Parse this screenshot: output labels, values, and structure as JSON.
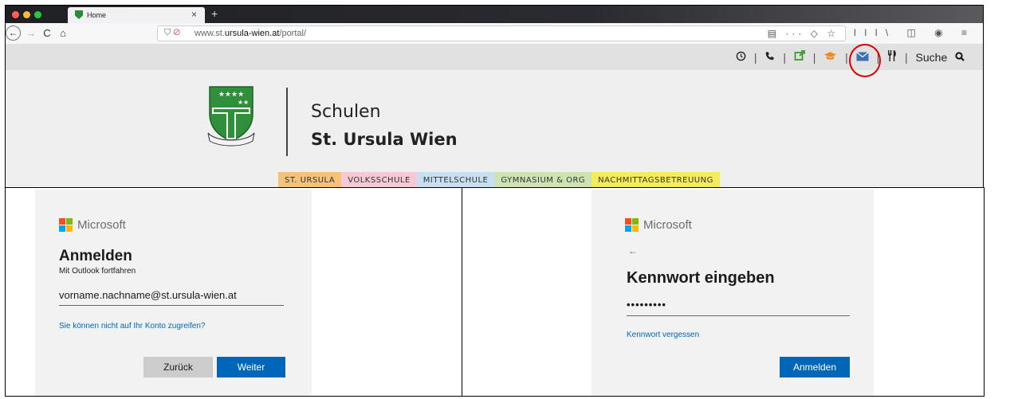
{
  "browser": {
    "tab_title": "Home",
    "tab_close": "×",
    "new_tab": "+",
    "url_prefix": "www.st.",
    "url_domain": "ursula-wien.at",
    "url_path": "/portal/",
    "nav": {
      "back": "←",
      "forward": "→",
      "reload": "C",
      "home": "⌂"
    },
    "url_icons": {
      "reader": "▤",
      "more": "···",
      "pocket": "◇",
      "bookmark": "☆"
    },
    "tool_icons": {
      "library": "III\\",
      "sidebar": "◫",
      "account": "◉",
      "menu": "≡"
    }
  },
  "site": {
    "utility": {
      "clock_icon": "clock-icon",
      "phone_icon": "phone-icon",
      "external_icon": "external-link-icon",
      "graduation_icon": "graduation-cap-icon",
      "mail_icon": "mail-icon",
      "food_icon": "cutlery-icon",
      "separator": "|",
      "search_label": "Suche"
    },
    "brand_line1": "Schulen",
    "brand_line2": "St. Ursula Wien",
    "menu": [
      {
        "label": "ST. URSULA",
        "color": "#f5c27a"
      },
      {
        "label": "VOLKSSCHULE",
        "color": "#f6c9d6"
      },
      {
        "label": "MITTELSCHULE",
        "color": "#c7dff0"
      },
      {
        "label": "GYMNASIUM & ORG",
        "color": "#cfe3b2"
      },
      {
        "label": "NACHMITTAGSBETREUUNG",
        "color": "#f5ec5c"
      }
    ],
    "highlight_color": "#dd0000"
  },
  "signin": {
    "brand": "Microsoft",
    "title": "Anmelden",
    "subtitle": "Mit Outlook fortfahren",
    "email_value": "vorname.nachname@st.ursula-wien.at",
    "help_link": "Sie können nicht auf Ihr Konto zugreifen?",
    "back_button": "Zurück",
    "next_button": "Weiter"
  },
  "password": {
    "brand": "Microsoft",
    "back_arrow": "←",
    "title": "Kennwort eingeben",
    "password_value": "•••••••••",
    "forgot_link": "Kennwort vergessen",
    "submit_button": "Anmelden"
  },
  "colors": {
    "ms_blue": "#0067b8",
    "ms_logo": [
      "#f25022",
      "#7fba00",
      "#00a4ef",
      "#ffb900"
    ]
  }
}
